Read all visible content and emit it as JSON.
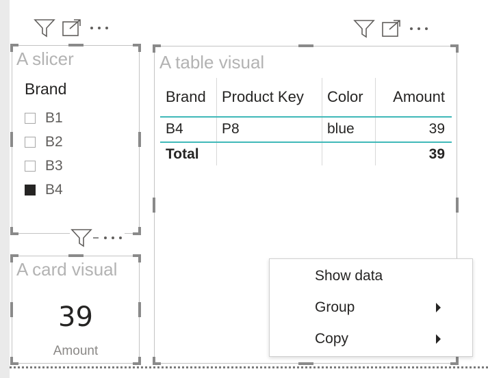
{
  "slicer": {
    "title": "A slicer",
    "header": "Brand",
    "items": [
      {
        "label": "B1",
        "checked": false
      },
      {
        "label": "B2",
        "checked": false
      },
      {
        "label": "B3",
        "checked": false
      },
      {
        "label": "B4",
        "checked": true
      }
    ]
  },
  "card": {
    "title": "A card visual",
    "value": "39",
    "label": "Amount"
  },
  "table": {
    "title": "A table visual",
    "columns": [
      "Brand",
      "Product Key",
      "Color",
      "Amount"
    ],
    "rows": [
      [
        "B4",
        "P8",
        "blue",
        "39"
      ]
    ],
    "total": [
      "Total",
      "",
      "",
      "39"
    ]
  },
  "context_menu": {
    "items": [
      {
        "label": "Show data",
        "submenu": false
      },
      {
        "label": "Group",
        "submenu": true
      },
      {
        "label": "Copy",
        "submenu": true
      }
    ]
  },
  "colors": {
    "grid_line": "#3fb8b8",
    "handle": "#8a8a8a",
    "title_placeholder": "#b3b3b3"
  }
}
